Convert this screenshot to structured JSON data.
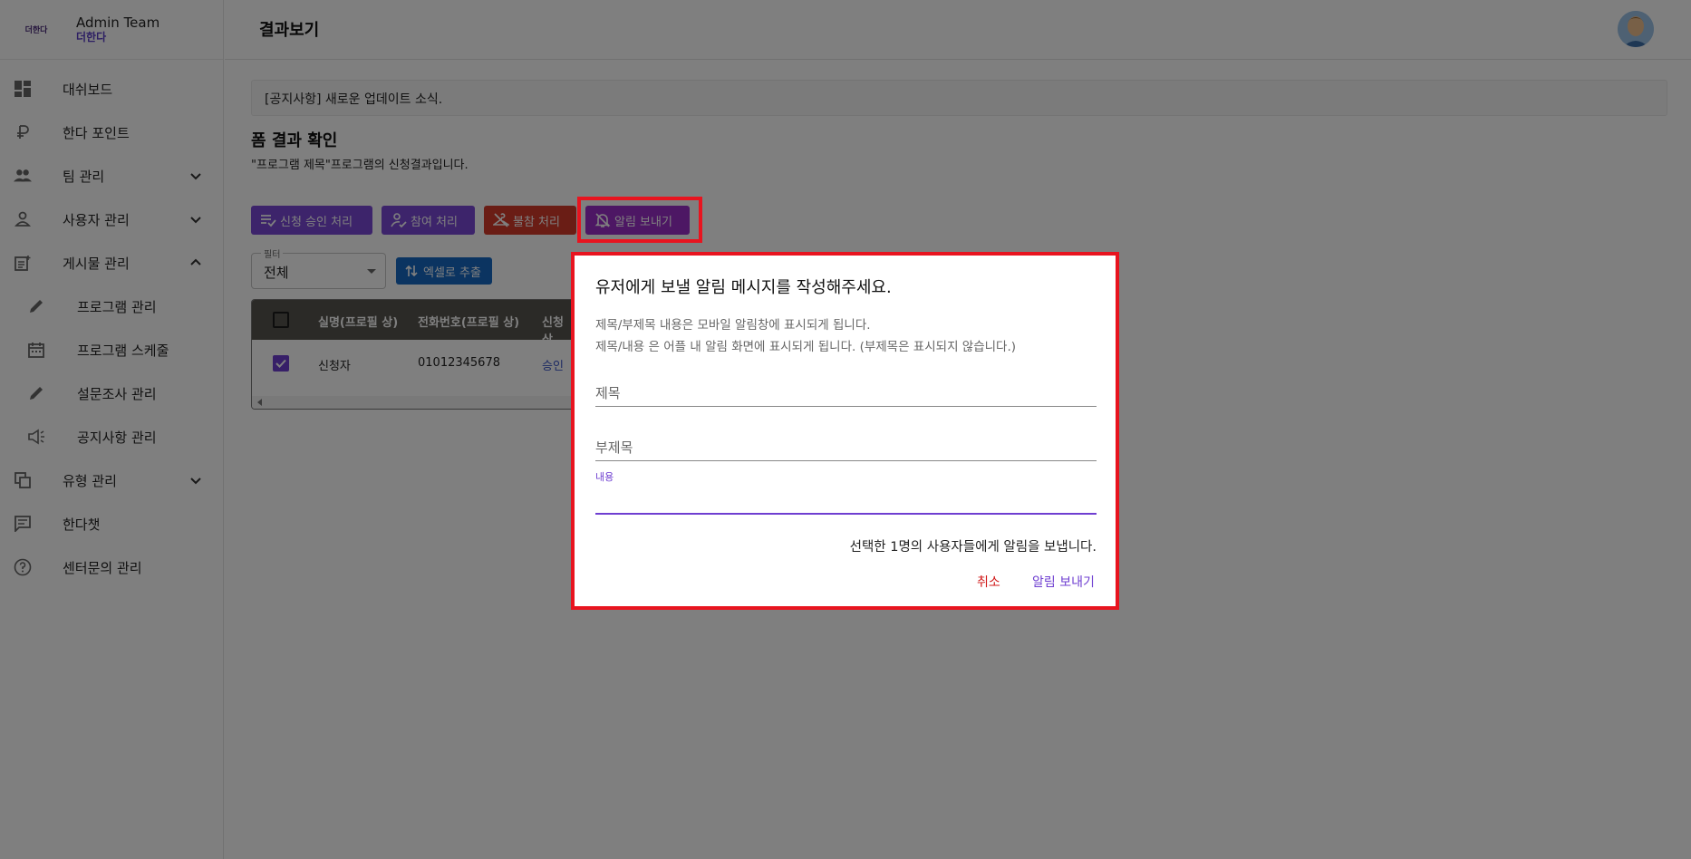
{
  "brand": {
    "logo_text": "더한다",
    "title": "Admin Team",
    "subtitle": "더한다"
  },
  "sidebar": {
    "items": [
      {
        "label": "대쉬보드",
        "icon": "dashboard-icon"
      },
      {
        "label": "한다 포인트",
        "icon": "ruble-icon"
      },
      {
        "label": "팀 관리",
        "icon": "people-icon",
        "expandable": true
      },
      {
        "label": "사용자 관리",
        "icon": "person-icon",
        "expandable": true
      },
      {
        "label": "게시물 관리",
        "icon": "post-add-icon",
        "expanded": true
      },
      {
        "label": "프로그램 관리",
        "icon": "pencil-icon",
        "sub": true
      },
      {
        "label": "프로그램 스케줄",
        "icon": "calendar-icon",
        "sub": true
      },
      {
        "label": "설문조사 관리",
        "icon": "pencil-icon",
        "sub": true
      },
      {
        "label": "공지사항 관리",
        "icon": "megaphone-icon",
        "sub": true
      },
      {
        "label": "유형 관리",
        "icon": "copy-icon",
        "expandable": true
      },
      {
        "label": "한다챗",
        "icon": "chat-icon"
      },
      {
        "label": "센터문의 관리",
        "icon": "help-icon"
      }
    ]
  },
  "header": {
    "title": "결과보기"
  },
  "notice": {
    "text": "[공지사항] 새로운 업데이트 소식."
  },
  "form": {
    "title": "폼 결과 확인",
    "description": "\"프로그램 제목\"프로그램의 신청결과입니다."
  },
  "actions": {
    "approve": "신청 승인 처리",
    "participate": "참여 처리",
    "absent": "불참 처리",
    "alert": "알림 보내기"
  },
  "filter": {
    "label": "필터",
    "value": "전체"
  },
  "excel": {
    "label": "엑셀로 추출"
  },
  "table": {
    "headers": [
      "실명(프로필 상)",
      "전화번호(프로필 상)",
      "신청 상"
    ],
    "rows": [
      {
        "checked": true,
        "name": "신청자",
        "phone": "01012345678",
        "status": "승인"
      }
    ]
  },
  "dialog": {
    "title": "유저에게 보낼 알림 메시지를 작성해주세요.",
    "desc_line1": "제목/부제목 내용은 모바일 알림창에 표시되게 됩니다.",
    "desc_line2": "제목/내용 은 어플 내 알림 화면에 표시되게 됩니다. (부제목은 표시되지 않습니다.)",
    "title_placeholder": "제목",
    "subtitle_placeholder": "부제목",
    "content_label": "내용",
    "note": "선택한 1명의 사용자들에게 알림을 보냅니다.",
    "cancel": "취소",
    "send": "알림 보내기"
  },
  "colors": {
    "primary": "#7a48d6",
    "danger": "#d53a2b",
    "alert": "#9a2ec8",
    "excel": "#1769c2",
    "highlight": "#e8141f"
  }
}
